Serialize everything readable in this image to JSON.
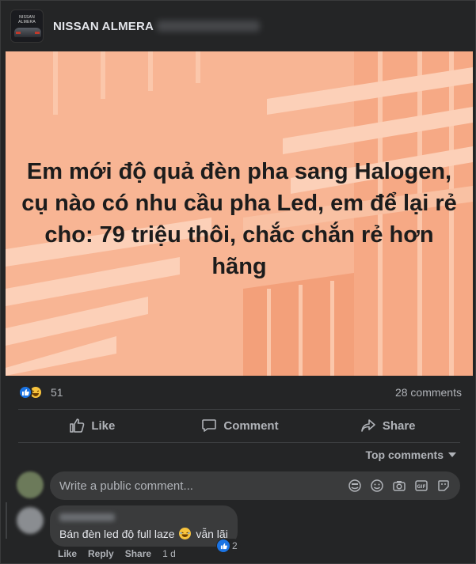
{
  "group": {
    "name": "NISSAN ALMERA",
    "avatar_text": "NISSAN ALMERA"
  },
  "post": {
    "text": "Em mới độ quả đèn pha sang Halogen, cụ nào có nhu cầu pha Led, em để lại rẻ cho: 79 triệu thôi, chắc chắn rẻ hơn hãng",
    "image_bg": "#f7b492"
  },
  "stats": {
    "reaction_count": "51",
    "comments": "28 comments",
    "reactions": [
      "like-icon",
      "haha-icon"
    ]
  },
  "actions": {
    "like": "Like",
    "comment": "Comment",
    "share": "Share"
  },
  "comments_sort": {
    "label": "Top comments"
  },
  "comment_box": {
    "placeholder": "Write a public comment..."
  },
  "comment": {
    "text_before": "Bán đèn led độ full laze",
    "text_after": "vẫn lãi",
    "reaction_count": "2",
    "meta": {
      "like": "Like",
      "reply": "Reply",
      "share": "Share",
      "time": "1 d"
    }
  },
  "colors": {
    "background": "#242526",
    "accent": "#1b74e4",
    "muted": "#b0b3b8",
    "bubble": "#3a3b3c"
  }
}
